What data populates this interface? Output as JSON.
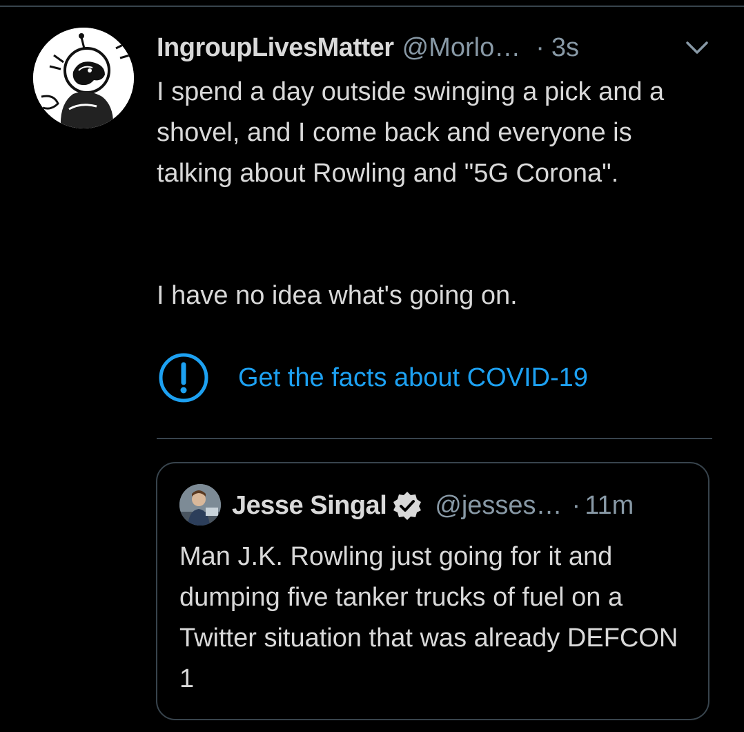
{
  "tweet": {
    "display_name": "IngroupLivesMatter",
    "handle": "@Morlo…",
    "separator": "·",
    "time": "3s",
    "menu_icon": "chevron-down-icon",
    "avatar_icon": "astronaut-dog-avatar",
    "text_part1": "I spend a day outside swinging a pick and a shovel, and I come back and everyone is talking about Rowling and \"5G Corona\".",
    "text_part2": "I have no idea what's going on."
  },
  "covid_notice": {
    "icon": "exclamation-circle-icon",
    "label": "Get the facts about COVID-19"
  },
  "quoted_tweet": {
    "display_name": "Jesse Singal",
    "verified_icon": "verified-badge-icon",
    "handle": "@jesses…",
    "separator": "·",
    "time": "11m",
    "text": "Man J.K. Rowling just going for it and dumping five tanker trucks of fuel on a Twitter situation that was already DEFCON 1"
  },
  "colors": {
    "background": "#000000",
    "text_primary": "#d9d9d9",
    "text_secondary": "#8899a6",
    "accent_blue": "#1da1f2",
    "border": "#38444d"
  }
}
